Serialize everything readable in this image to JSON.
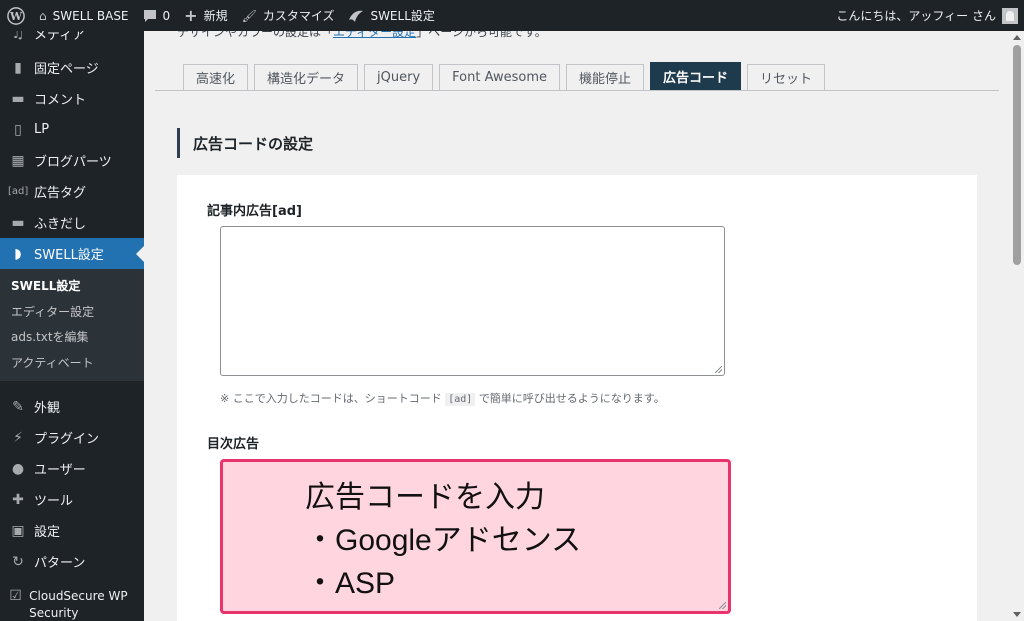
{
  "adminbar": {
    "site_name": "SWELL BASE",
    "comments_count": "0",
    "new_label": "新規",
    "customize_label": "カスタマイズ",
    "swell_settings_label": "SWELL設定",
    "greeting": "こんにちは、アッフィー さん"
  },
  "sidebar": {
    "items": [
      {
        "label": "メディア",
        "icon": "media-icon"
      },
      {
        "label": "固定ページ",
        "icon": "page-icon"
      },
      {
        "label": "コメント",
        "icon": "comment-icon"
      },
      {
        "label": "LP",
        "icon": "lp-icon"
      },
      {
        "label": "ブログパーツ",
        "icon": "blog-parts-icon"
      },
      {
        "label": "広告タグ",
        "icon": "ad-tag-icon",
        "icon_text": "[ad]"
      },
      {
        "label": "ふきだし",
        "icon": "balloon-icon"
      },
      {
        "label": "SWELL設定",
        "icon": "swell-icon",
        "current": true
      }
    ],
    "submenu": [
      {
        "label": "SWELL設定",
        "current": true
      },
      {
        "label": "エディター設定"
      },
      {
        "label": "ads.txtを編集"
      },
      {
        "label": "アクティベート"
      }
    ],
    "items2": [
      {
        "label": "外観",
        "icon": "appearance-icon"
      },
      {
        "label": "プラグイン",
        "icon": "plugin-icon"
      },
      {
        "label": "ユーザー",
        "icon": "user-icon"
      },
      {
        "label": "ツール",
        "icon": "tools-icon"
      },
      {
        "label": "設定",
        "icon": "settings-icon"
      },
      {
        "label": "パターン",
        "icon": "pattern-icon"
      },
      {
        "label": "CloudSecure WP Security",
        "icon": "cloudsecure-icon"
      }
    ]
  },
  "main": {
    "top_note_prefix": "デザインやカラーの設定は「",
    "top_note_link": "エディター設定",
    "top_note_suffix": "」ページから可能です。",
    "tabs": [
      {
        "label": "高速化"
      },
      {
        "label": "構造化データ"
      },
      {
        "label": "jQuery"
      },
      {
        "label": "Font Awesome"
      },
      {
        "label": "機能停止"
      },
      {
        "label": "広告コード",
        "active": true
      },
      {
        "label": "リセット"
      }
    ],
    "section_title": "広告コードの設定",
    "field1_label": "記事内広告[ad]",
    "help_prefix": "※ ここで入力したコードは、ショートコード",
    "help_code": "[ad]",
    "help_suffix": "で簡単に呼び出せるようになります。",
    "field2_label": "目次広告",
    "annotation": {
      "line1": "広告コードを入力",
      "line2": "・Googleアドセンス",
      "line3": "・ASP"
    }
  },
  "colors": {
    "admin_dark": "#1d2327",
    "current_blue": "#2271b1",
    "active_tab": "#1e3a4d",
    "highlight_border": "#e8336d",
    "highlight_fill": "#ffd6e0"
  }
}
